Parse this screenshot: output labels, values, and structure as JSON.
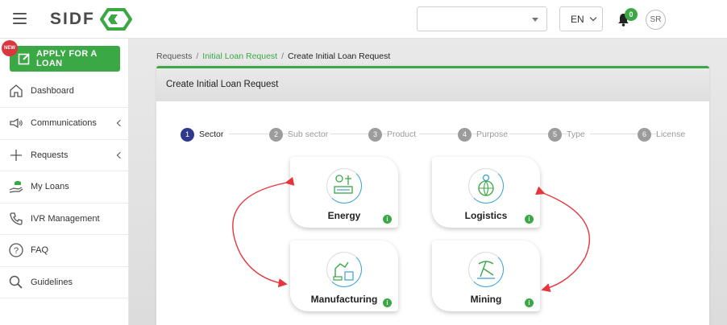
{
  "header": {
    "logo_text": "SIDF",
    "top_select_value": "",
    "language": "EN",
    "notifications_count": "0",
    "user_initials": "SR"
  },
  "sidebar": {
    "apply_button": "APPLY FOR A LOAN",
    "new_badge": "NEW",
    "items": [
      {
        "label": "Dashboard",
        "icon": "home-icon"
      },
      {
        "label": "Communications",
        "icon": "megaphone-icon"
      },
      {
        "label": "Requests",
        "icon": "plus-icon"
      },
      {
        "label": "My Loans",
        "icon": "loans-icon"
      },
      {
        "label": "IVR Management",
        "icon": "phone-icon"
      },
      {
        "label": "FAQ",
        "icon": "question-icon"
      },
      {
        "label": "Guidelines",
        "icon": "search-icon"
      }
    ]
  },
  "breadcrumb": {
    "root": "Requests",
    "link": "Initial Loan Request",
    "current": "Create Initial Loan Request"
  },
  "card": {
    "title": "Create Initial Loan Request"
  },
  "steps": [
    {
      "num": "1",
      "label": "Sector"
    },
    {
      "num": "2",
      "label": "Sub sector"
    },
    {
      "num": "3",
      "label": "Product"
    },
    {
      "num": "4",
      "label": "Purpose"
    },
    {
      "num": "5",
      "label": "Type"
    },
    {
      "num": "6",
      "label": "License"
    }
  ],
  "sectors": [
    {
      "label": "Energy",
      "icon": "energy-icon"
    },
    {
      "label": "Logistics",
      "icon": "logistics-icon"
    },
    {
      "label": "Manufacturing",
      "icon": "manufacturing-icon"
    },
    {
      "label": "Mining",
      "icon": "mining-icon"
    }
  ],
  "colors": {
    "brand_green": "#3aa845",
    "active_step": "#2f3b8a",
    "arrow_red": "#e8353b"
  }
}
